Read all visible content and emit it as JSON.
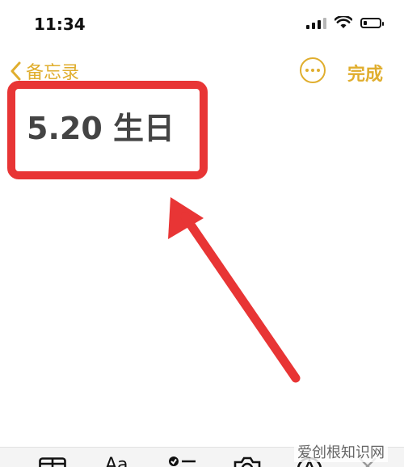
{
  "status_bar": {
    "time": "11:34",
    "signal_icon": "cellular-signal-icon",
    "wifi_icon": "wifi-icon",
    "battery_icon": "battery-low-icon"
  },
  "nav": {
    "back_label": "备忘录",
    "back_icon": "chevron-left-icon",
    "more_icon": "ellipsis-circle-icon",
    "done_label": "完成"
  },
  "note": {
    "title": "5.20 生日"
  },
  "annotation": {
    "box_color": "#e83535",
    "arrow_color": "#e83535"
  },
  "toolbar": {
    "icons": [
      "table-icon",
      "text-format-icon",
      "checklist-icon",
      "camera-icon",
      "markup-icon",
      "close-icon"
    ],
    "format_label": "Aa"
  },
  "watermark": {
    "text": "爱创根知识网"
  },
  "colors": {
    "accent": "#e0ae2e",
    "title_text": "#444444"
  }
}
